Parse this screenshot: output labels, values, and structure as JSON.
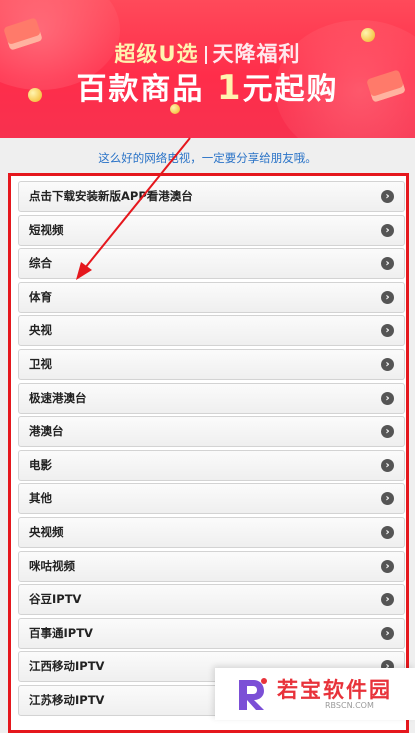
{
  "banner": {
    "line1_a": "超级U选",
    "line1_b": "天降福利",
    "line2_a": "百款商品",
    "line2_num": "1",
    "line2_b": "元起购"
  },
  "caption": "这么好的网络电视，一定要分享给朋友哦。",
  "list": {
    "items": [
      "点击下载安装新版APP看港澳台",
      "短视频",
      "综合",
      "体育",
      "央视",
      "卫视",
      "极速港澳台",
      "港澳台",
      "电影",
      "其他",
      "央视频",
      "咪咕视频",
      "谷豆IPTV",
      "百事通IPTV",
      "江西移动IPTV",
      "江苏移动IPTV"
    ]
  },
  "watermark": {
    "text": "若宝软件园",
    "sub": "RBSCN.COM"
  },
  "colors": {
    "banner": "#ff2d4a",
    "caption": "#2a73c7",
    "frame": "#e5171d",
    "arrow": "#e5171d",
    "watermark": "#e8323a"
  }
}
